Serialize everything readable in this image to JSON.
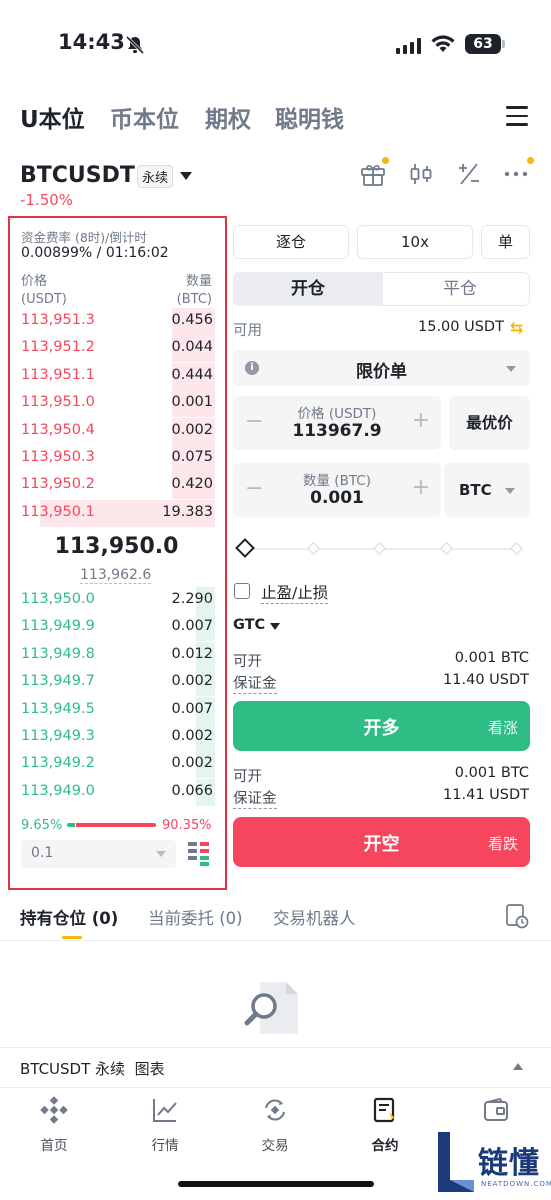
{
  "status": {
    "time": "14:43",
    "battery": "63"
  },
  "top_tabs": [
    {
      "label": "U本位"
    },
    {
      "label": "币本位"
    },
    {
      "label": "期权"
    },
    {
      "label": "聪明钱"
    }
  ],
  "symbol": {
    "name": "BTCUSDT",
    "badge": "永续",
    "change": "-1.50%"
  },
  "orderbook": {
    "funding_label": "资金费率 (8时)/倒计时",
    "funding_value": "0.00899% / 01:16:02",
    "price_header": "价格",
    "price_unit": "(USDT)",
    "qty_header": "数量",
    "qty_unit": "(BTC)",
    "asks": [
      {
        "price": "113,951.3",
        "qty": "0.456",
        "depth": 0.22
      },
      {
        "price": "113,951.2",
        "qty": "0.044",
        "depth": 0.22
      },
      {
        "price": "113,951.1",
        "qty": "0.444",
        "depth": 0.22
      },
      {
        "price": "113,951.0",
        "qty": "0.001",
        "depth": 0.22
      },
      {
        "price": "113,950.4",
        "qty": "0.002",
        "depth": 0.22
      },
      {
        "price": "113,950.3",
        "qty": "0.075",
        "depth": 0.22
      },
      {
        "price": "113,950.2",
        "qty": "0.420",
        "depth": 0.22
      },
      {
        "price": "113,950.1",
        "qty": "19.383",
        "depth": 0.9
      }
    ],
    "last_price": "113,950.0",
    "mark_price": "113,962.6",
    "bids": [
      {
        "price": "113,950.0",
        "qty": "2.290",
        "depth": 0.1
      },
      {
        "price": "113,949.9",
        "qty": "0.007",
        "depth": 0.1
      },
      {
        "price": "113,949.8",
        "qty": "0.012",
        "depth": 0.1
      },
      {
        "price": "113,949.7",
        "qty": "0.002",
        "depth": 0.1
      },
      {
        "price": "113,949.5",
        "qty": "0.007",
        "depth": 0.1
      },
      {
        "price": "113,949.3",
        "qty": "0.002",
        "depth": 0.1
      },
      {
        "price": "113,949.2",
        "qty": "0.002",
        "depth": 0.1
      },
      {
        "price": "113,949.0",
        "qty": "0.066",
        "depth": 0.1
      }
    ],
    "buy_ratio": "9.65%",
    "sell_ratio": "90.35%",
    "depth_step": "0.1"
  },
  "order_form": {
    "margin_mode": "逐仓",
    "leverage": "10x",
    "position_mode": "单",
    "tab_open": "开仓",
    "tab_close": "平仓",
    "available_label": "可用",
    "available_value": "15.00 USDT",
    "order_type": "限价单",
    "price_label": "价格 (USDT)",
    "price_value": "113967.9",
    "best_price": "最优价",
    "qty_label": "数量 (BTC)",
    "qty_value": "0.001",
    "qty_unit": "BTC",
    "tpsl_label": "止盈/止损",
    "tif": "GTC",
    "long_info": {
      "open_label": "可开",
      "open_value": "0.001 BTC",
      "margin_label": "保证金",
      "margin_value": "11.40 USDT"
    },
    "long_button": "开多",
    "long_sub": "看涨",
    "short_info": {
      "open_label": "可开",
      "open_value": "0.001 BTC",
      "margin_label": "保证金",
      "margin_value": "11.41 USDT"
    },
    "short_button": "开空",
    "short_sub": "看跌"
  },
  "position_tabs": [
    {
      "label": "持有仓位 (0)"
    },
    {
      "label": "当前委托 (0)"
    },
    {
      "label": "交易机器人"
    }
  ],
  "chart_bar": {
    "label": "BTCUSDT 永续  图表"
  },
  "bottom_nav": [
    {
      "label": "首页",
      "icon": "home-icon"
    },
    {
      "label": "行情",
      "icon": "markets-icon"
    },
    {
      "label": "交易",
      "icon": "trade-icon"
    },
    {
      "label": "合约",
      "icon": "futures-icon"
    },
    {
      "label": "",
      "icon": "wallet-icon"
    }
  ],
  "watermark": {
    "text": "链懂",
    "sub": "NEATDOWN.COM"
  },
  "colors": {
    "up": "#2ebd85",
    "down": "#f6465d",
    "accent": "#f0b90b",
    "highlight_frame": "#e2333f"
  }
}
